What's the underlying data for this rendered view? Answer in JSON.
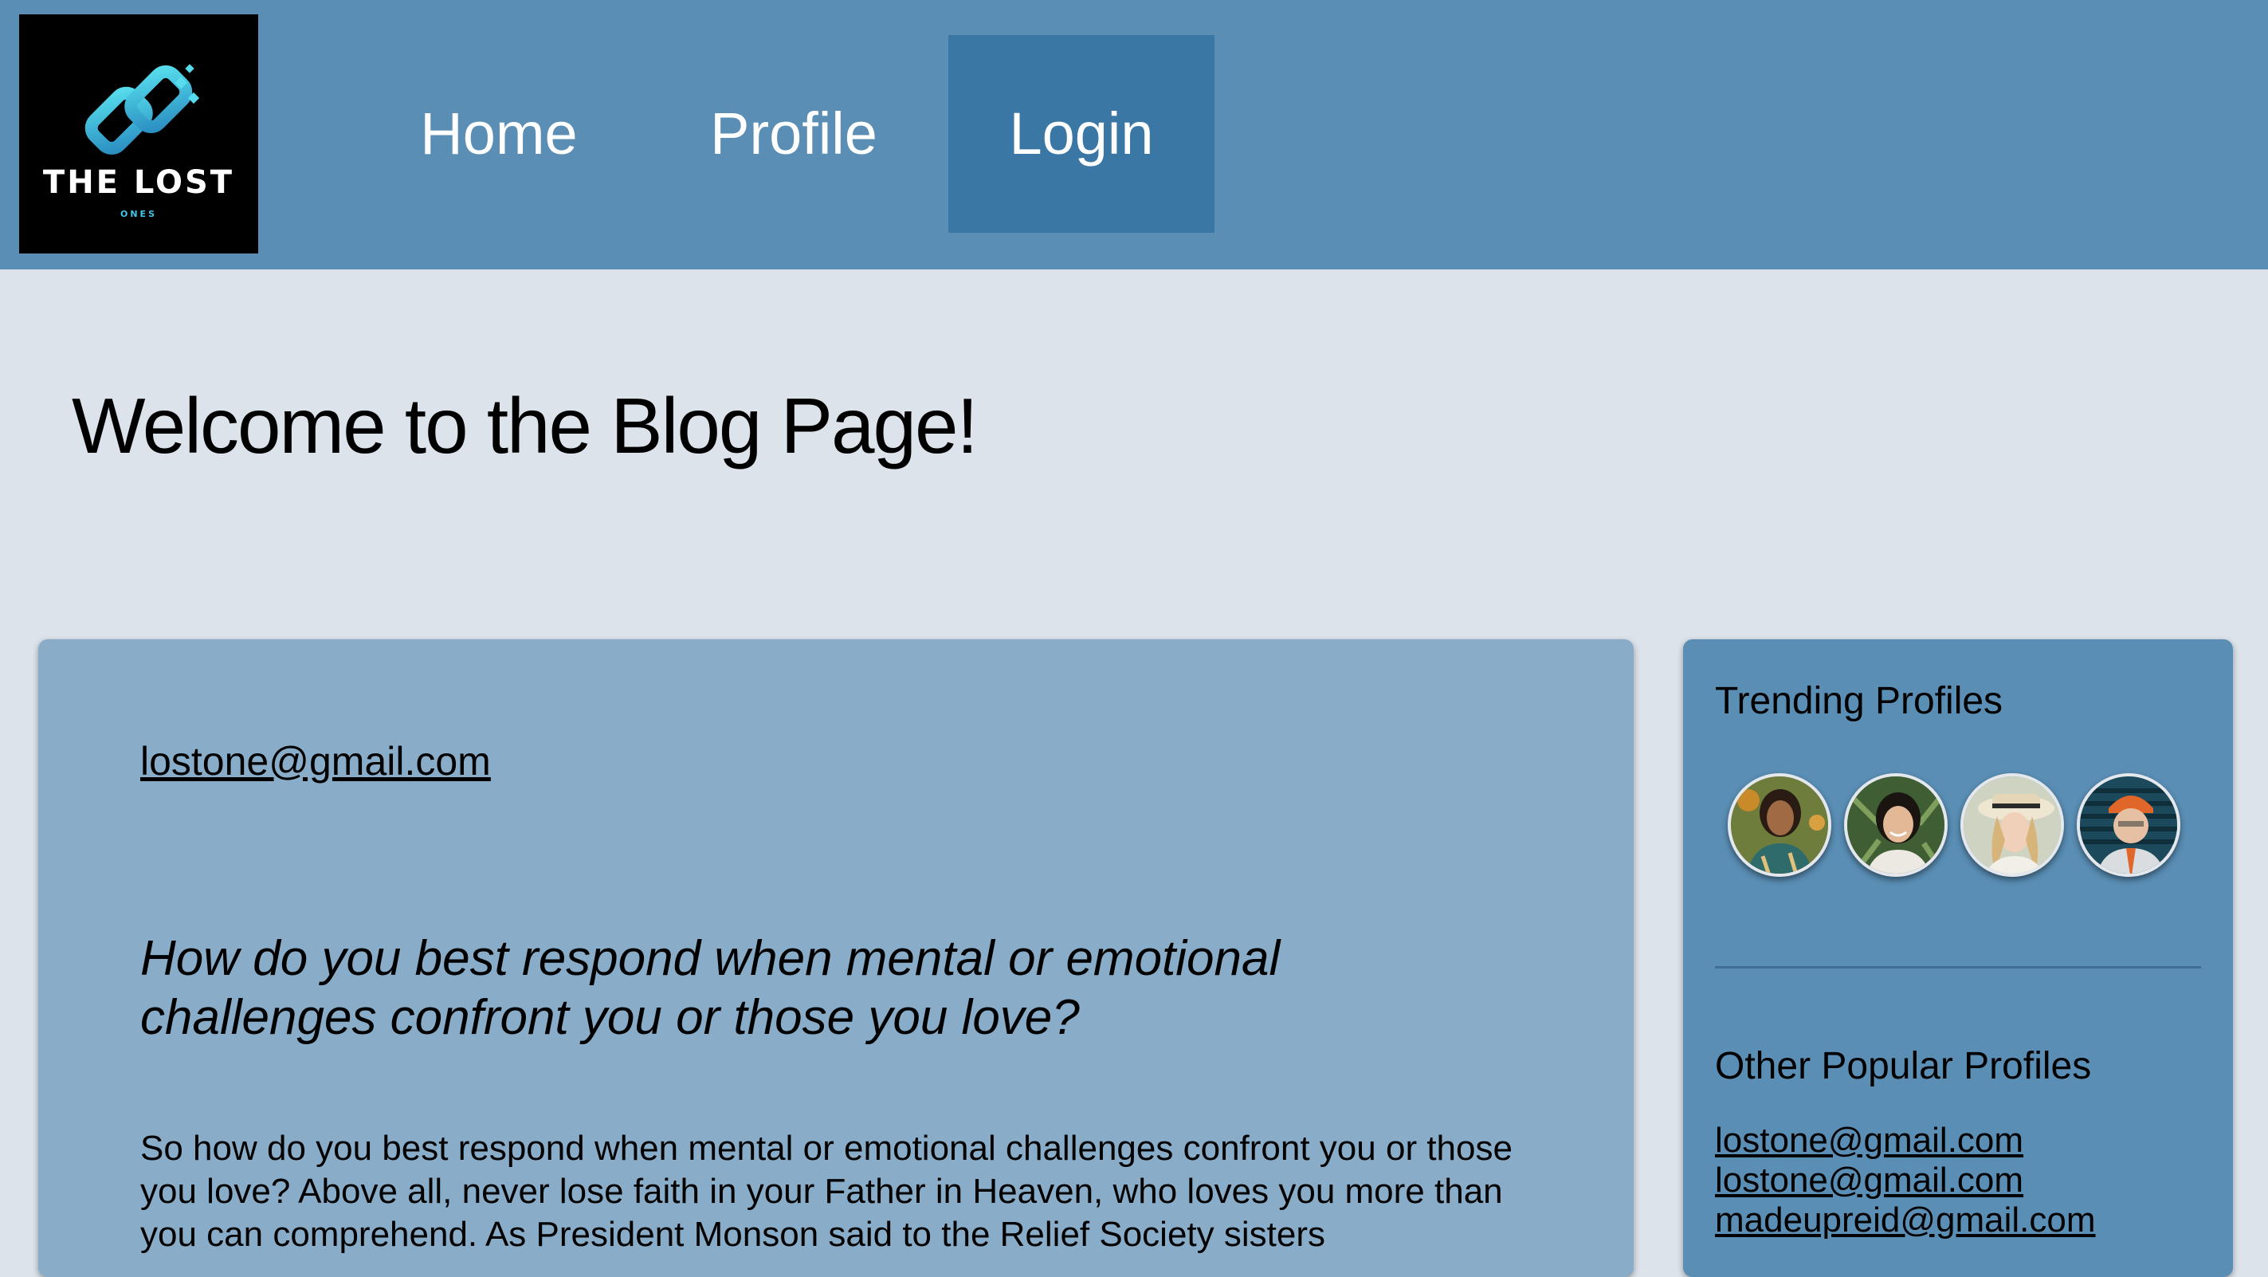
{
  "logo": {
    "title": "THE LOST",
    "subtitle": "ONES",
    "icon": "chain-link-logo-icon",
    "accent_color": "#45c6e6"
  },
  "nav": {
    "items": [
      {
        "label": "Home",
        "active": false
      },
      {
        "label": "Profile",
        "active": false
      },
      {
        "label": "Login",
        "active": true
      }
    ],
    "bar_color": "#5a8eb5",
    "active_color": "#3b77a5"
  },
  "page": {
    "title": "Welcome to the Blog Page!",
    "background": "#dce3eb"
  },
  "post": {
    "author": "lostone@gmail.com",
    "title": "How do you best respond when mental or emotional challenges confront you or those you love?",
    "body": "So how do you best respond when mental or emotional challenges confront you or those you love? Above all, never lose faith in your Father in Heaven, who loves you more than you can comprehend. As President Monson said to the Relief Society sisters",
    "card_color": "#89adc9"
  },
  "sidebar": {
    "trending_heading": "Trending Profiles",
    "trending_profiles": [
      {
        "icon": "profile-avatar-icon"
      },
      {
        "icon": "profile-avatar-icon"
      },
      {
        "icon": "profile-avatar-icon"
      },
      {
        "icon": "profile-avatar-icon"
      }
    ],
    "popular_heading": "Other Popular Profiles",
    "popular_profiles": [
      "lostone@gmail.com",
      "lostone@gmail.com",
      "madeupreid@gmail.com"
    ],
    "card_color": "#5a8eb5"
  }
}
